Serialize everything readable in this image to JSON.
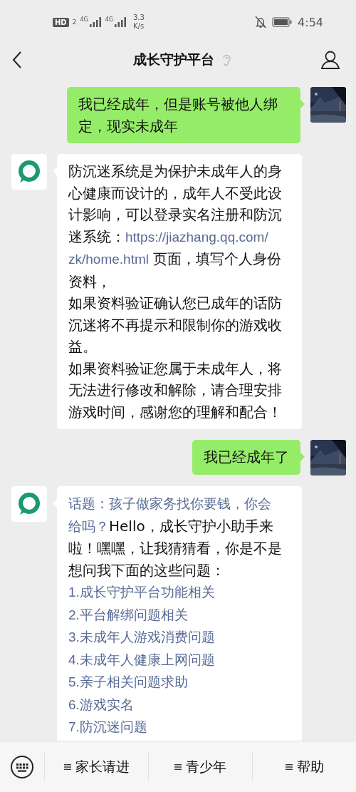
{
  "status_bar": {
    "hd": "HD",
    "sim": "2",
    "networks": [
      "4G",
      "4G"
    ],
    "speed": [
      "3.3",
      "K/s"
    ],
    "time": "4:54"
  },
  "header": {
    "title": "成长守护平台"
  },
  "messages": [
    {
      "kind": "sent",
      "paragraphs": [
        [
          {
            "kind": "text",
            "text": "我已经成年，但是账号被他人绑定，现实未成年"
          }
        ]
      ]
    },
    {
      "kind": "received",
      "paragraphs": [
        [
          {
            "kind": "text",
            "text": "防沉迷系统是为保护未成年人的身心健康而设计的，成年人不受此设计影响，可以登录实名注册和防沉迷系统："
          },
          {
            "kind": "link",
            "text": "https://jiazhang.qq.com/"
          },
          {
            "kind": "link",
            "text": "zk/home.html"
          },
          {
            "kind": "text",
            "text": " 页面，填写个人身份资料，"
          }
        ],
        [
          {
            "kind": "text",
            "text": "如果资料验证确认您已成年的话防沉迷将不再提示和限制你的游戏收益。"
          }
        ],
        [
          {
            "kind": "text",
            "text": "如果资料验证您属于未成年人，将无法进行修改和解除，请合理安排游戏时间，感谢您的理解和配合！"
          }
        ]
      ]
    },
    {
      "kind": "sent",
      "paragraphs": [
        [
          {
            "kind": "text",
            "text": "我已经成年了"
          }
        ]
      ]
    },
    {
      "kind": "received",
      "paragraphs": [
        [
          {
            "kind": "link",
            "text": "话题：孩子做家务找你要钱，你会"
          },
          {
            "kind": "link",
            "text": "给吗？"
          },
          {
            "kind": "text",
            "text": "Hello，成长守护小助手来啦！嘿嘿，让我猜猜看，你是不是想问我下面的这些问题："
          }
        ],
        [
          {
            "kind": "link",
            "text": "1.成长守护平台功能相关"
          }
        ],
        [
          {
            "kind": "link",
            "text": "2.平台解绑问题相关"
          }
        ],
        [
          {
            "kind": "link",
            "text": "3.未成年人游戏消费问题"
          }
        ],
        [
          {
            "kind": "link",
            "text": "4.未成年人健康上网问题"
          }
        ],
        [
          {
            "kind": "link",
            "text": "5.亲子相关问题求助"
          }
        ],
        [
          {
            "kind": "link",
            "text": "6.游戏实名"
          }
        ],
        [
          {
            "kind": "link",
            "text": "7.防沉迷问题"
          }
        ]
      ]
    }
  ],
  "menu": [
    "家长请进",
    "青少年",
    "帮助"
  ]
}
